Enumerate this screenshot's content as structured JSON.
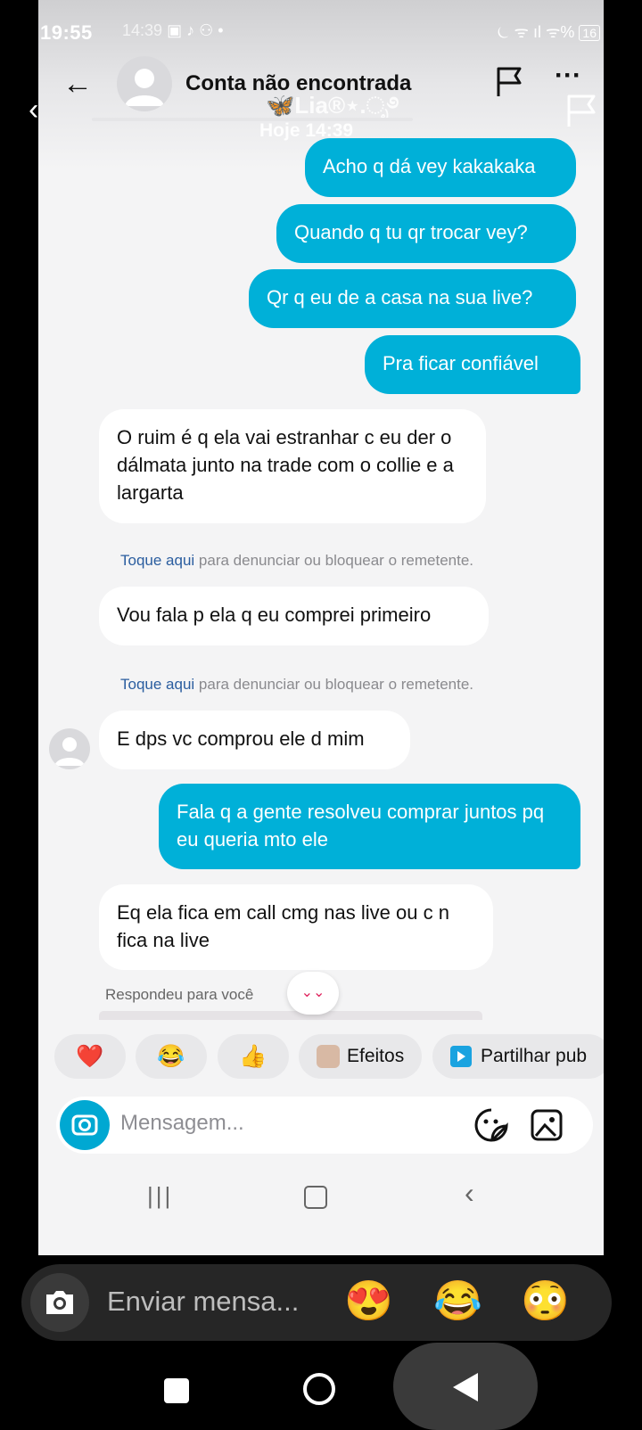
{
  "status": {
    "time": "19:55",
    "overlay_time": "14:39",
    "battery": "16",
    "right_icons": "⏾ ᯤ ıl ᯤ% "
  },
  "header": {
    "title": "Conta não encontrada"
  },
  "story_overlay": {
    "name": "🦋Lia®⋆.ೃ࿔",
    "date": "Hoje 14:39"
  },
  "messages": [
    {
      "dir": "out",
      "text": "Acho q dá vey kakakaka"
    },
    {
      "dir": "out",
      "text": "Quando q tu qr trocar vey?"
    },
    {
      "dir": "out",
      "text": "Qr q eu de a casa na sua live?"
    },
    {
      "dir": "out",
      "text": "Pra ficar confiável"
    },
    {
      "dir": "in",
      "text": "O ruim é q ela vai estranhar c eu der o dálmata junto na trade com o collie e a largarta"
    },
    {
      "dir": "in",
      "text": "Vou fala p ela q eu comprei primeiro"
    },
    {
      "dir": "in",
      "text": "E dps vc comprou ele d mim"
    },
    {
      "dir": "out",
      "text": "Fala q a gente resolveu comprar juntos pq eu queria mto ele"
    },
    {
      "dir": "in",
      "text": "Eq ela fica em call cmg nas live ou c n fica na live"
    }
  ],
  "notice": {
    "link": "Toque aqui",
    "text": " para denunciar ou bloquear o remetente."
  },
  "replied_label": "Respondeu para você",
  "chips": [
    {
      "icon": "❤️"
    },
    {
      "icon": "😂"
    },
    {
      "icon": "👍"
    },
    {
      "icon": "face-thumbnail",
      "label": "Efeitos"
    },
    {
      "icon": "play-square",
      "label": "Partilhar pub"
    }
  ],
  "composer": {
    "placeholder": "Mensagem..."
  },
  "outer_reply": {
    "placeholder": "Enviar mensa...",
    "emojis": [
      "😍",
      "😂",
      "😳"
    ]
  },
  "colors": {
    "outgoing": "#00b0d8",
    "incoming": "#ffffff",
    "background": "#f4f4f5",
    "link": "#2a5d9f"
  }
}
